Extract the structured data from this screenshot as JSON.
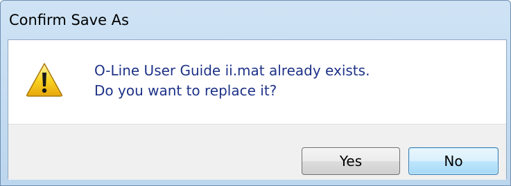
{
  "window": {
    "title": "Confirm Save As"
  },
  "message": {
    "line1": "O-Line User Guide ii.mat already exists.",
    "line2": "Do you want to replace it?"
  },
  "icon": {
    "name": "warning-icon",
    "color": "#f5c60f"
  },
  "buttons": {
    "yes_label": "Yes",
    "no_label": "No"
  },
  "colors": {
    "message_text": "#1e3287",
    "titlebar": "#cfe3f5",
    "default_button_border": "#3c7fb1"
  }
}
